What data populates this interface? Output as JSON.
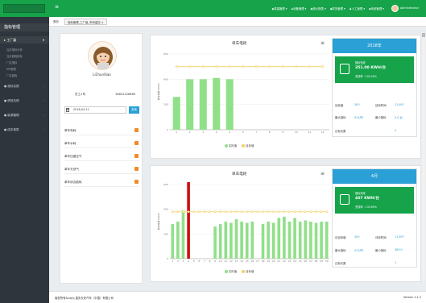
{
  "header": {
    "menu_icon": "hamburger-icon",
    "nav": [
      "◆质量管理 ▾",
      "◈设备管理 ▾",
      "◉统计报表 ▾",
      "◆财务管理 ▾",
      "♟人工管理 ▾",
      "◆系统管理 ▾"
    ],
    "user": "Administrator"
  },
  "sidebar": {
    "title": "指标管理",
    "section": "工厂级",
    "sub_items": [
      "当月指标分析",
      "当月能耗指标",
      "厂区指标",
      "KPI管理",
      "厂区能耗"
    ],
    "items": [
      "指标实绩",
      "绩效实绩",
      "能源管理",
      "成本核算"
    ]
  },
  "tabs": {
    "home": "首页",
    "current": "指标管理_工厂级_车间监控 ×"
  },
  "profile": {
    "name": "LiChunXiao",
    "label": "员工1号",
    "phone": "18631226869",
    "date": "2018-04-11",
    "query_label": "查询",
    "menu": [
      "单车电耗",
      "单车水耗",
      "单车压缩空气",
      "单车天然气",
      "单车综合能耗"
    ]
  },
  "panel1": {
    "title": "单车电耗",
    "legend": [
      "实际值",
      "目标值"
    ],
    "colors": {
      "actual": "#90e08a",
      "target": "#f0d060"
    }
  },
  "panel2": {
    "title": "单车电耗",
    "legend": [
      "实际值",
      "目标值"
    ],
    "colors": {
      "actual": "#90e08a",
      "target": "#f0d060",
      "highlight": "#cc1111"
    }
  },
  "stats1": {
    "header": "2018年",
    "card_label": "指标完成",
    "card_value": "351.00 KWH/台",
    "card_rate": "完成率 : 105.00%",
    "rows": [
      [
        "目标值",
        "300",
        "目标时间",
        "11,897"
      ],
      [
        "最大指标",
        "412/时",
        "最小指标",
        "0.0 台"
      ],
      [
        "达标天数",
        "0",
        ""
      ]
    ]
  },
  "stats2": {
    "header": "4月",
    "card_label": "指标完成",
    "card_value": "407 KWH/台",
    "card_rate": "完成率 : 135.69%",
    "rows": [
      [
        "月目标值",
        "300",
        "月标时间",
        "11,897"
      ],
      [
        "最大指标",
        "412/时",
        "最小指标",
        "380.0"
      ],
      [
        "达标天数",
        "1",
        ""
      ]
    ]
  },
  "footer": {
    "copyright": "版权所有&copy;重庆长安汽车（中国）有限公司",
    "version": "Version 2.1.2"
  },
  "chart_data": [
    {
      "type": "bar",
      "categories": [
        "1",
        "2",
        "3",
        "4",
        "5",
        "6",
        "7",
        "8",
        "9",
        "10",
        "11",
        "12"
      ],
      "series": [
        {
          "name": "实际值",
          "values": [
            260,
            400,
            400,
            410,
            400,
            0,
            0,
            0,
            0,
            0,
            0,
            0
          ]
        },
        {
          "name": "目标值",
          "values": [
            500,
            500,
            500,
            500,
            500,
            500,
            500,
            500,
            500,
            500,
            500,
            500
          ]
        }
      ],
      "title": "单车电耗",
      "ylabel": "单车电耗 KW/H",
      "yticks": [
        0,
        200,
        400,
        600
      ],
      "ylim": [
        0,
        600
      ]
    },
    {
      "type": "bar",
      "categories": [
        "1",
        "2",
        "3",
        "4",
        "5",
        "6",
        "7",
        "8",
        "9",
        "10",
        "11",
        "12",
        "13",
        "14",
        "15",
        "16",
        "17",
        "18",
        "19",
        "20",
        "21",
        "22",
        "23",
        "24",
        "25",
        "26",
        "27",
        "28",
        "29",
        "30"
      ],
      "series": [
        {
          "name": "实际值",
          "values": [
            280,
            300,
            390,
            620,
            0,
            0,
            0,
            0,
            260,
            280,
            300,
            290,
            320,
            300,
            290,
            300,
            0,
            280,
            300,
            290,
            330,
            340,
            300,
            330,
            300,
            310,
            300,
            290,
            300,
            300
          ]
        },
        {
          "name": "目标值",
          "values": [
            380,
            380,
            380,
            380,
            380,
            380,
            380,
            380,
            380,
            380,
            380,
            380,
            380,
            380,
            380,
            380,
            380,
            380,
            380,
            380,
            380,
            380,
            380,
            380,
            380,
            380,
            380,
            380,
            380,
            380
          ]
        }
      ],
      "highlight_index": 3,
      "title": "单车电耗",
      "ylabel": "单车电耗 KW/H",
      "yticks": [
        0,
        200,
        400,
        600
      ],
      "ylim": [
        0,
        600
      ]
    }
  ]
}
